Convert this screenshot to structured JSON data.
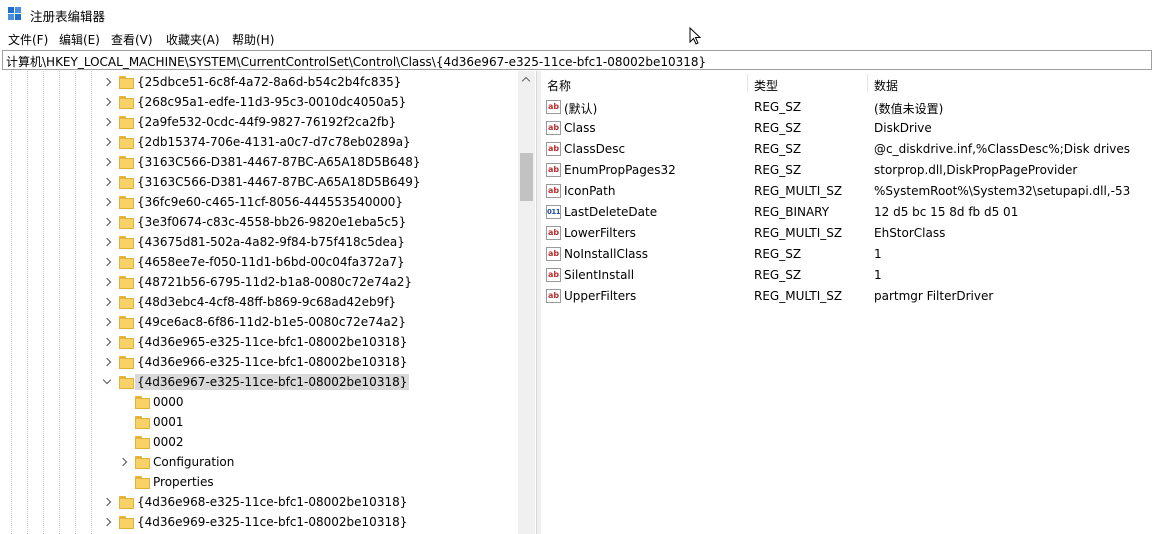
{
  "window": {
    "title": "注册表编辑器"
  },
  "menu": [
    "文件(F)",
    "编辑(E)",
    "查看(V)",
    "收藏夹(A)",
    "帮助(H)"
  ],
  "address": "计算机\\HKEY_LOCAL_MACHINE\\SYSTEM\\CurrentControlSet\\Control\\Class\\{4d36e967-e325-11ce-bfc1-08002be10318}",
  "tree": [
    {
      "label": "{25dbce51-6c8f-4a72-8a6d-b54c2b4fc835}",
      "level": 0,
      "expander": "collapsed"
    },
    {
      "label": "{268c95a1-edfe-11d3-95c3-0010dc4050a5}",
      "level": 0,
      "expander": "collapsed"
    },
    {
      "label": "{2a9fe532-0cdc-44f9-9827-76192f2ca2fb}",
      "level": 0,
      "expander": "collapsed"
    },
    {
      "label": "{2db15374-706e-4131-a0c7-d7c78eb0289a}",
      "level": 0,
      "expander": "collapsed"
    },
    {
      "label": "{3163C566-D381-4467-87BC-A65A18D5B648}",
      "level": 0,
      "expander": "collapsed"
    },
    {
      "label": "{3163C566-D381-4467-87BC-A65A18D5B649}",
      "level": 0,
      "expander": "collapsed"
    },
    {
      "label": "{36fc9e60-c465-11cf-8056-444553540000}",
      "level": 0,
      "expander": "collapsed"
    },
    {
      "label": "{3e3f0674-c83c-4558-bb26-9820e1eba5c5}",
      "level": 0,
      "expander": "collapsed"
    },
    {
      "label": "{43675d81-502a-4a82-9f84-b75f418c5dea}",
      "level": 0,
      "expander": "collapsed"
    },
    {
      "label": "{4658ee7e-f050-11d1-b6bd-00c04fa372a7}",
      "level": 0,
      "expander": "collapsed"
    },
    {
      "label": "{48721b56-6795-11d2-b1a8-0080c72e74a2}",
      "level": 0,
      "expander": "collapsed"
    },
    {
      "label": "{48d3ebc4-4cf8-48ff-b869-9c68ad42eb9f}",
      "level": 0,
      "expander": "collapsed"
    },
    {
      "label": "{49ce6ac8-6f86-11d2-b1e5-0080c72e74a2}",
      "level": 0,
      "expander": "collapsed"
    },
    {
      "label": "{4d36e965-e325-11ce-bfc1-08002be10318}",
      "level": 0,
      "expander": "collapsed"
    },
    {
      "label": "{4d36e966-e325-11ce-bfc1-08002be10318}",
      "level": 0,
      "expander": "collapsed"
    },
    {
      "label": "{4d36e967-e325-11ce-bfc1-08002be10318}",
      "level": 0,
      "expander": "expanded",
      "selected": true
    },
    {
      "label": "0000",
      "level": 1,
      "expander": "none"
    },
    {
      "label": "0001",
      "level": 1,
      "expander": "none"
    },
    {
      "label": "0002",
      "level": 1,
      "expander": "none"
    },
    {
      "label": "Configuration",
      "level": 1,
      "expander": "collapsed"
    },
    {
      "label": "Properties",
      "level": 1,
      "expander": "none"
    },
    {
      "label": "{4d36e968-e325-11ce-bfc1-08002be10318}",
      "level": 0,
      "expander": "collapsed"
    },
    {
      "label": "{4d36e969-e325-11ce-bfc1-08002be10318}",
      "level": 0,
      "expander": "collapsed"
    }
  ],
  "columns": {
    "name": "名称",
    "type": "类型",
    "data": "数据"
  },
  "values": [
    {
      "name": "(默认)",
      "type": "REG_SZ",
      "data": "(数值未设置)",
      "icon": "string-value-icon"
    },
    {
      "name": "Class",
      "type": "REG_SZ",
      "data": "DiskDrive",
      "icon": "string-value-icon"
    },
    {
      "name": "ClassDesc",
      "type": "REG_SZ",
      "data": "@c_diskdrive.inf,%ClassDesc%;Disk drives",
      "icon": "string-value-icon"
    },
    {
      "name": "EnumPropPages32",
      "type": "REG_SZ",
      "data": "storprop.dll,DiskPropPageProvider",
      "icon": "string-value-icon"
    },
    {
      "name": "IconPath",
      "type": "REG_MULTI_SZ",
      "data": "%SystemRoot%\\System32\\setupapi.dll,-53",
      "icon": "string-value-icon"
    },
    {
      "name": "LastDeleteDate",
      "type": "REG_BINARY",
      "data": "12 d5 bc 15 8d fb d5 01",
      "icon": "binary-value-icon"
    },
    {
      "name": "LowerFilters",
      "type": "REG_MULTI_SZ",
      "data": "EhStorClass",
      "icon": "string-value-icon"
    },
    {
      "name": "NoInstallClass",
      "type": "REG_SZ",
      "data": "1",
      "icon": "string-value-icon"
    },
    {
      "name": "SilentInstall",
      "type": "REG_SZ",
      "data": "1",
      "icon": "string-value-icon"
    },
    {
      "name": "UpperFilters",
      "type": "REG_MULTI_SZ",
      "data": "partmgr FilterDriver",
      "icon": "string-value-icon"
    }
  ],
  "icons": {
    "string": "ab",
    "binary": "011"
  }
}
